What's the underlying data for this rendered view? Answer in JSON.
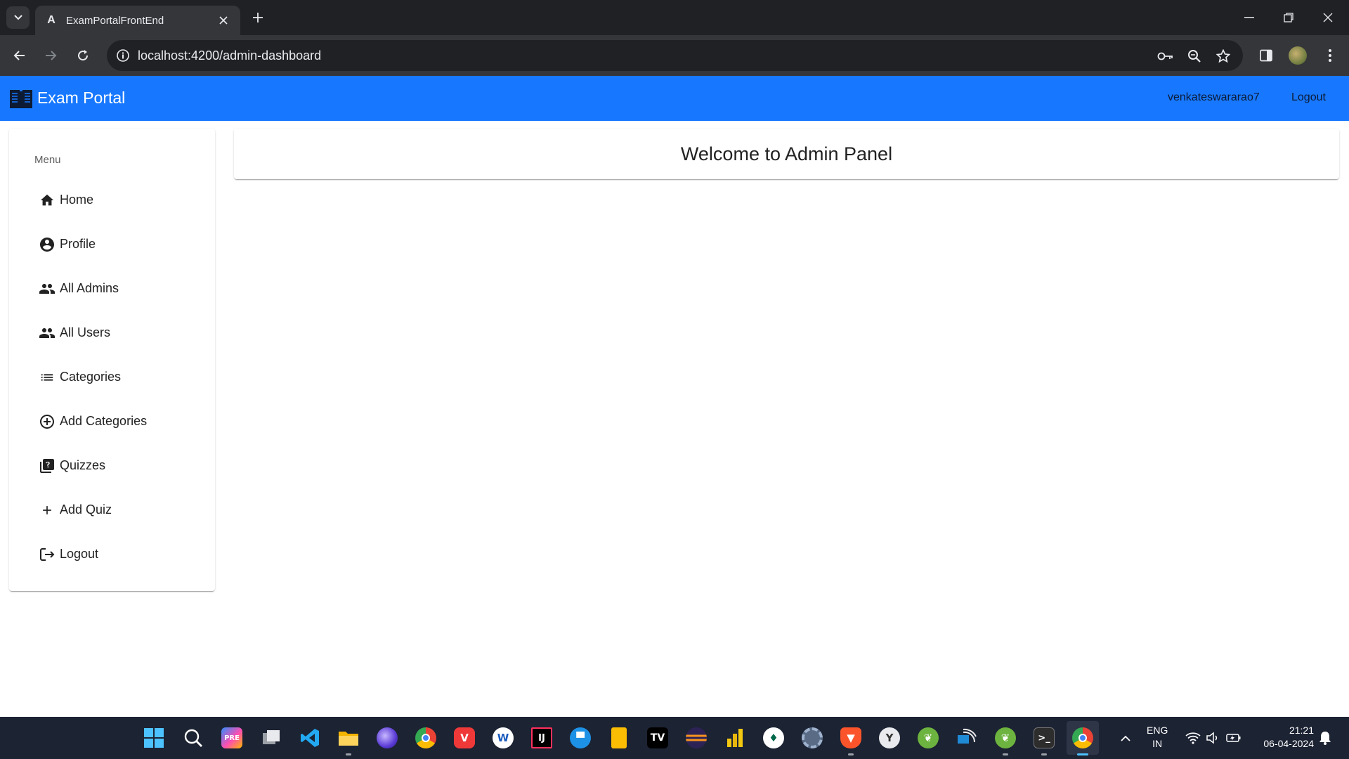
{
  "browser": {
    "tab_title": "ExamPortalFrontEnd",
    "tab_favicon_letter": "A",
    "url": "localhost:4200/admin-dashboard"
  },
  "navbar": {
    "brand": "Exam Portal",
    "username": "venkateswararao7",
    "logout_label": "Logout",
    "background_color": "#1778ff"
  },
  "sidebar": {
    "heading": "Menu",
    "items": [
      {
        "label": "Home",
        "icon": "home-icon"
      },
      {
        "label": "Profile",
        "icon": "account-circle-icon"
      },
      {
        "label": "All Admins",
        "icon": "people-icon"
      },
      {
        "label": "All Users",
        "icon": "people-icon"
      },
      {
        "label": "Categories",
        "icon": "list-icon"
      },
      {
        "label": "Add Categories",
        "icon": "add-circle-icon"
      },
      {
        "label": "Quizzes",
        "icon": "quiz-icon"
      },
      {
        "label": "Add Quiz",
        "icon": "plus-icon"
      },
      {
        "label": "Logout",
        "icon": "logout-icon"
      }
    ]
  },
  "main": {
    "welcome_title": "Welcome to Admin Panel"
  },
  "taskbar": {
    "apps": [
      "start",
      "search",
      "copilot",
      "task-view",
      "vscode",
      "file-explorer",
      "firefox-dev",
      "chrome",
      "vivaldi",
      "word",
      "intellij",
      "docker",
      "keep",
      "terminal-tv",
      "eclipse",
      "power-bi",
      "mongodb-compass",
      "settings",
      "brave",
      "clock",
      "spring-tool",
      "remote-desktop",
      "spring-boot",
      "terminal",
      "chrome-active"
    ],
    "language": "ENG",
    "region": "IN",
    "time": "21:21",
    "date": "06-04-2024"
  }
}
